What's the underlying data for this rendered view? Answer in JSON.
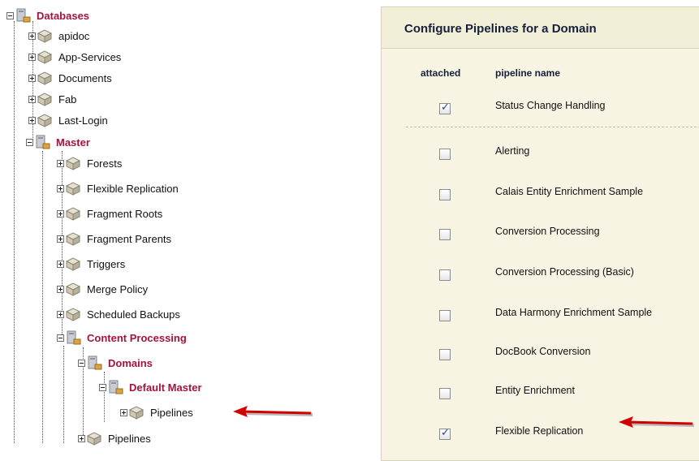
{
  "tree": {
    "root": "Databases",
    "databases": [
      "apidoc",
      "App-Services",
      "Documents",
      "Fab",
      "Last-Login"
    ],
    "master": "Master",
    "master_children": [
      "Forests",
      "Flexible Replication",
      "Fragment Roots",
      "Fragment Parents",
      "Triggers",
      "Merge Policy",
      "Scheduled Backups"
    ],
    "content_processing": "Content Processing",
    "domains": "Domains",
    "default_master": "Default Master",
    "domain_pipelines": "Pipelines",
    "cp_pipelines": "Pipelines"
  },
  "panel": {
    "title": "Configure Pipelines for a Domain",
    "col_attached": "attached",
    "col_name": "pipeline name",
    "pipelines": [
      {
        "name": "Status Change Handling",
        "attached": true
      },
      {
        "name": "Alerting",
        "attached": false
      },
      {
        "name": "Calais Entity Enrichment Sample",
        "attached": false
      },
      {
        "name": "Conversion Processing",
        "attached": false
      },
      {
        "name": "Conversion Processing (Basic)",
        "attached": false
      },
      {
        "name": "Data Harmony Enrichment Sample",
        "attached": false
      },
      {
        "name": "DocBook Conversion",
        "attached": false
      },
      {
        "name": "Entity Enrichment",
        "attached": false
      },
      {
        "name": "Flexible Replication",
        "attached": true
      }
    ]
  },
  "colors": {
    "accent_red": "#a4123f",
    "arrow_red": "#d10000",
    "panel_bg": "#f7f4e4"
  }
}
